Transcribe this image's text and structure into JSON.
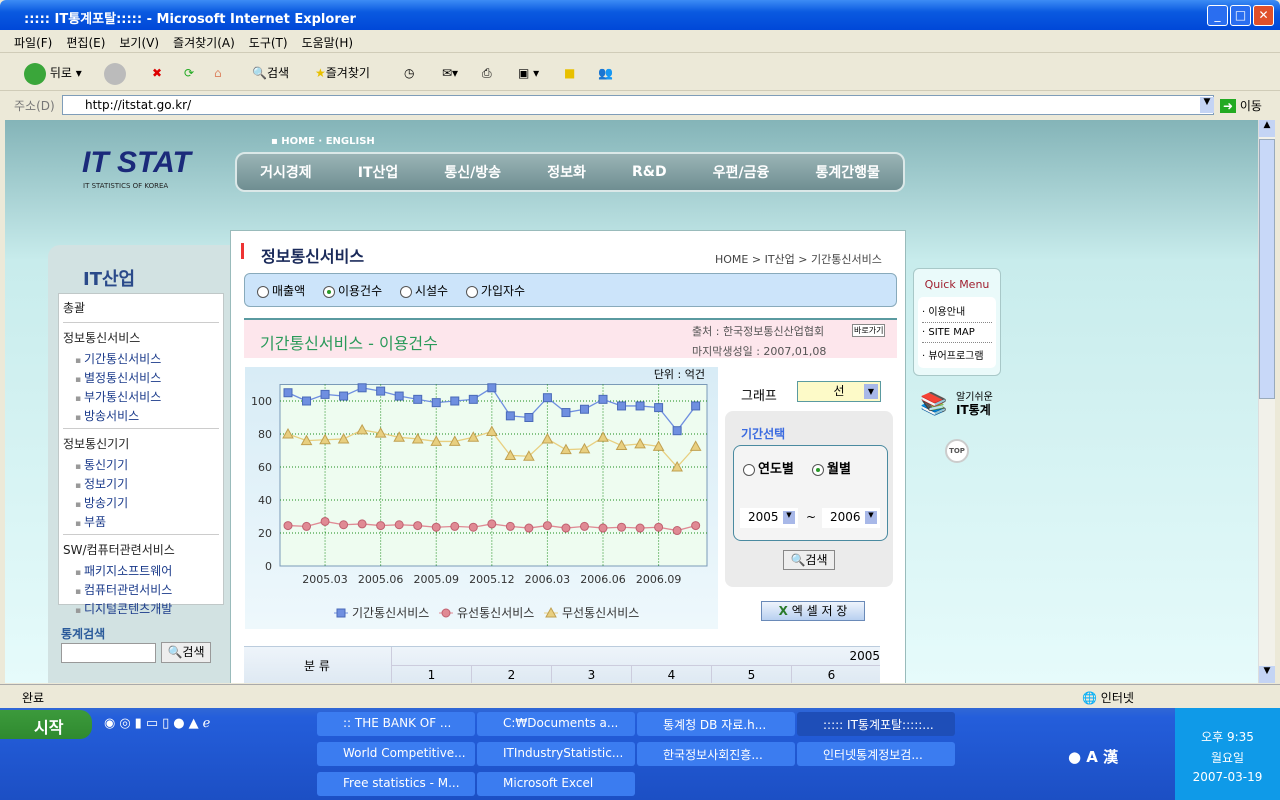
{
  "window": {
    "title": "::::: IT통계포탈::::: - Microsoft Internet Explorer"
  },
  "menu": [
    "파일(F)",
    "편집(E)",
    "보기(V)",
    "즐겨찾기(A)",
    "도구(T)",
    "도움말(H)"
  ],
  "toolbar": {
    "back": "뒤로",
    "search": "검색",
    "favorites": "즐겨찾기"
  },
  "address": {
    "label": "주소(D)",
    "url": "http://itstat.go.kr/",
    "go": "이동"
  },
  "site": {
    "logo": "IT STAT",
    "logo_sub": "IT STATISTICS OF KOREA",
    "top_links": [
      "HOME",
      "ENGLISH"
    ],
    "nav": [
      "거시경제",
      "IT산업",
      "통신/방송",
      "정보화",
      "R&D",
      "우편/금융",
      "통계간행물"
    ],
    "left": {
      "title": "IT산업",
      "groups": [
        {
          "label": "총괄",
          "items": []
        },
        {
          "label": "정보통신서비스",
          "items": [
            "기간통신서비스",
            "별정통신서비스",
            "부가통신서비스",
            "방송서비스"
          ]
        },
        {
          "label": "정보통신기기",
          "items": [
            "통신기기",
            "정보기기",
            "방송기기",
            "부품"
          ]
        },
        {
          "label": "SW/컴퓨터관련서비스",
          "items": [
            "패키지소프트웨어",
            "컴퓨터관련서비스",
            "디지털콘텐츠개발"
          ]
        }
      ],
      "search_label": "통계검색",
      "search_button": "검색"
    },
    "main": {
      "heading": "정보통신서비스",
      "breadcrumb": "HOME > IT산업 > 기간통신서비스",
      "radios": [
        {
          "label": "매출액",
          "checked": false
        },
        {
          "label": "이용건수",
          "checked": true
        },
        {
          "label": "시설수",
          "checked": false
        },
        {
          "label": "가입자수",
          "checked": false
        }
      ],
      "subtitle": "기간통신서비스 - 이용건수",
      "source": "출처 : 한국정보통신산업협회",
      "goto": "바로가기",
      "updated": "마지막생성일 : 2007,01,08",
      "graph_label": "그래프",
      "graph_type": "선",
      "period_title": "기간선택",
      "period_radios": [
        {
          "label": "연도별",
          "checked": false
        },
        {
          "label": "월별",
          "checked": true
        }
      ],
      "from_year": "2005",
      "to_year": "2006",
      "tilde": "~",
      "search": "검색",
      "excel": "엑 셀 저 장",
      "table": {
        "header": "분 류",
        "year": "2005",
        "cols": [
          "1",
          "2",
          "3",
          "4",
          "5",
          "6"
        ]
      }
    },
    "quick": {
      "title": "Quick Menu",
      "items": [
        "이용안내",
        "SITE MAP",
        "뷰어프로그램"
      ],
      "easy1": "알기쉬운",
      "easy2": "IT통계",
      "top": "TOP"
    }
  },
  "chart_data": {
    "type": "line",
    "unit_label": "단위 : 억건",
    "ylim": [
      0,
      110
    ],
    "yticks": [
      0,
      20,
      40,
      60,
      80,
      100
    ],
    "x": [
      "2005.01",
      "2005.02",
      "2005.03",
      "2005.04",
      "2005.05",
      "2005.06",
      "2005.07",
      "2005.08",
      "2005.09",
      "2005.10",
      "2005.11",
      "2005.12",
      "2006.01",
      "2006.02",
      "2006.03",
      "2006.04",
      "2006.05",
      "2006.06",
      "2006.07",
      "2006.08",
      "2006.09",
      "2006.10",
      "2006.11"
    ],
    "xtick_labels": [
      "2005.03",
      "2005.06",
      "2005.09",
      "2005.12",
      "2006.03",
      "2006.06",
      "2006.09"
    ],
    "grid": true,
    "legend": "bottom",
    "series": [
      {
        "name": "기간통신서비스",
        "color": "#6f8fe0",
        "marker": "square",
        "values": [
          105,
          100,
          104,
          103,
          108,
          106,
          103,
          101,
          99,
          100,
          101,
          108,
          91,
          90,
          102,
          93,
          95,
          101,
          97,
          97,
          96,
          82,
          97
        ]
      },
      {
        "name": "유선통신서비스",
        "color": "#e08a94",
        "marker": "circle",
        "values": [
          24.5,
          24,
          27,
          25,
          25.5,
          24.5,
          25,
          24.5,
          23.5,
          24,
          23.5,
          25.5,
          24,
          23,
          24.5,
          23,
          24,
          23,
          23.5,
          23,
          23.5,
          21.5,
          24.5
        ]
      },
      {
        "name": "무선통신서비스",
        "color": "#e8cf80",
        "marker": "triangle",
        "values": [
          80,
          76,
          76.5,
          77,
          82.5,
          80.5,
          78,
          77,
          75.5,
          75.5,
          78,
          81.5,
          67,
          66.5,
          77,
          70.5,
          71,
          78,
          73,
          74,
          72.5,
          60,
          72.5
        ]
      }
    ]
  },
  "status": {
    "text": "완료",
    "zone": "인터넷"
  },
  "taskbar": {
    "start": "시작",
    "tasks": [
      ":: THE BANK OF ...",
      "C:₩Documents a...",
      "통계청 DB 자료.h...",
      "::::: IT통계포탈:::::...",
      "World Competitive...",
      "ITIndustryStatistic...",
      "한국정보사회진흥...",
      "인터넷통계정보검...",
      "Free statistics - M...",
      "Microsoft Excel"
    ],
    "time": "오후 9:35",
    "day": "월요일",
    "date": "2007-03-19"
  }
}
